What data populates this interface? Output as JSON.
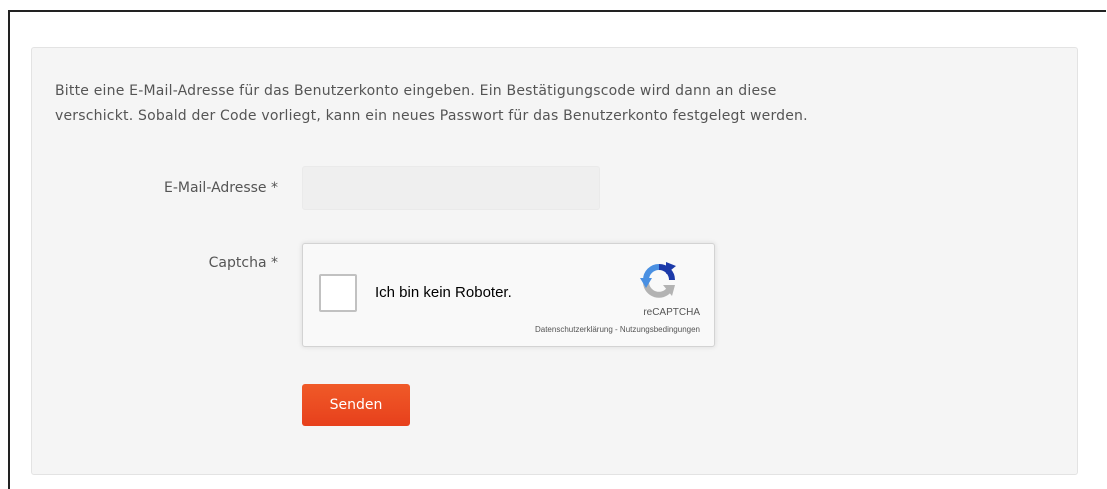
{
  "intro": {
    "line1": "Bitte eine E-Mail-Adresse für das Benutzerkonto eingeben. Ein Bestätigungscode wird dann an diese",
    "line2": "verschickt. Sobald der Code vorliegt, kann ein neues Passwort für das Benutzerkonto festgelegt werden."
  },
  "form": {
    "email_label": "E-Mail-Adresse *",
    "email_value": "",
    "email_placeholder": "",
    "captcha_label": "Captcha *",
    "submit_label": "Senden"
  },
  "recaptcha": {
    "checkbox_label": "Ich bin kein Roboter.",
    "brand": "reCAPTCHA",
    "privacy_link": "Datenschutzerklärung",
    "separator": " - ",
    "terms_link": "Nutzungsbedingungen",
    "checked": false,
    "logo_icon": "recaptcha-logo-icon"
  },
  "colors": {
    "panel_background": "#f5f5f5",
    "button_accent": "#e7401c",
    "recaptcha_blue": "#1c3aa9",
    "recaptcha_light_blue": "#4a90e2",
    "recaptcha_gray": "#b3b3b3"
  }
}
